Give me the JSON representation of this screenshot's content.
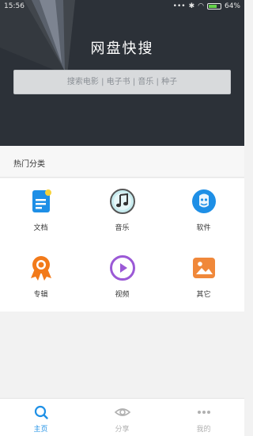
{
  "status_bar": {
    "time": "15:56",
    "battery": "64%",
    "battery_level": 0.64
  },
  "header": {
    "title": "网盘快搜"
  },
  "search": {
    "placeholder": "搜索电影 | 电子书 | 音乐 | 种子"
  },
  "categories_section": {
    "title": "热门分类",
    "items": [
      {
        "label": "文档",
        "icon": "document-icon",
        "color": "#1e8fe6"
      },
      {
        "label": "音乐",
        "icon": "music-icon",
        "color": "#5a5a5a"
      },
      {
        "label": "软件",
        "icon": "software-icon",
        "color": "#1e8fe6"
      },
      {
        "label": "专辑",
        "icon": "album-icon",
        "color": "#f27a1a"
      },
      {
        "label": "视频",
        "icon": "video-icon",
        "color": "#9b59d6"
      },
      {
        "label": "其它",
        "icon": "picture-icon",
        "color": "#f0883a"
      }
    ]
  },
  "tab_bar": {
    "tabs": [
      {
        "label": "主页",
        "icon": "search-icon",
        "active": true
      },
      {
        "label": "分享",
        "icon": "eye-icon",
        "active": false
      },
      {
        "label": "我的",
        "icon": "more-icon",
        "active": false
      }
    ],
    "active_color": "#1e90e6",
    "inactive_color": "#b0b0b0"
  }
}
